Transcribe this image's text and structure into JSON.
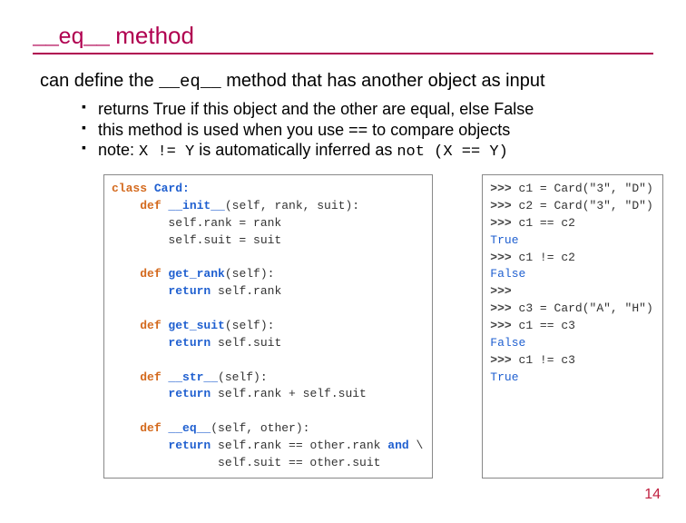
{
  "title_code": "__eq__",
  "title_word": " method",
  "desc_pre": "can define the ",
  "desc_code": "__eq__",
  "desc_post": " method that has another object as input",
  "bullets": {
    "b1": "returns True if this object and the other are equal, else False",
    "b2": "this method is used when you use == to compare objects",
    "b3_pre": "note: ",
    "b3_code1": "X != Y",
    "b3_mid": " is automatically inferred as ",
    "b3_code2": "not (X == Y)"
  },
  "code_left": {
    "l1_kw": "class",
    "l1_name": " Card:",
    "l2_kw": "def",
    "l2_fn": " __init__",
    "l2_sig": "(self, rank, suit):",
    "l3": "        self.rank = rank",
    "l4": "        self.suit = suit",
    "l5_kw": "def",
    "l5_fn": " get_rank",
    "l5_sig": "(self):",
    "l6_kw": "return",
    "l6_rest": " self.rank",
    "l7_kw": "def",
    "l7_fn": " get_suit",
    "l7_sig": "(self):",
    "l8_kw": "return",
    "l8_rest": " self.suit",
    "l9_kw": "def",
    "l9_fn": " __str__",
    "l9_sig": "(self):",
    "l10_kw": "return",
    "l10_rest": " self.rank + self.suit",
    "l11_kw": "def",
    "l11_fn": " __eq__",
    "l11_sig": "(self, other):",
    "l12_kw": "return",
    "l12_rest_a": " self.rank == other.rank ",
    "l12_and": "and",
    "l12_bs": " \\",
    "l13": "               self.suit == other.suit"
  },
  "shell": {
    "p": ">>> ",
    "s1": "c1 = Card(\"3\", \"D\")",
    "s2": "c2 = Card(\"3\", \"D\")",
    "s3": "c1 == c2",
    "r3": "True",
    "s4": "c1 != c2",
    "r4": "False",
    "s5": "",
    "s6": "c3 = Card(\"A\", \"H\")",
    "s7": "c1 == c3",
    "r7": "False",
    "s8": "c1 != c3",
    "r8": "True"
  },
  "pagenum": "14"
}
